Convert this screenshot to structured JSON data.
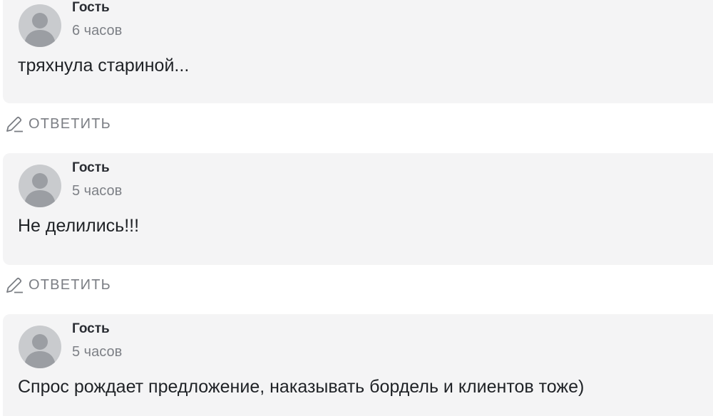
{
  "comments": [
    {
      "author": "Гость",
      "time": "6 часов",
      "text": "тряхнула стариной...",
      "avatar_icon": "default-user-avatar-icon"
    },
    {
      "author": "Гость",
      "time": "5 часов",
      "text": "Не делились!!!",
      "avatar_icon": "default-user-avatar-icon"
    },
    {
      "author": "Гость",
      "time": "5 часов",
      "text": "Спрос рождает предложение, наказывать бордель и клиентов тоже)",
      "avatar_icon": "default-user-avatar-icon"
    }
  ],
  "reply_label": "ОТВЕТИТЬ",
  "reply_icon": "pencil-icon",
  "colors": {
    "card_background": "#f4f4f5",
    "avatar_background": "#c9cbce",
    "avatar_figure": "#9b9ea3",
    "author_text": "#2a2d33",
    "meta_text": "#7d8086",
    "body_text": "#1f2226"
  }
}
